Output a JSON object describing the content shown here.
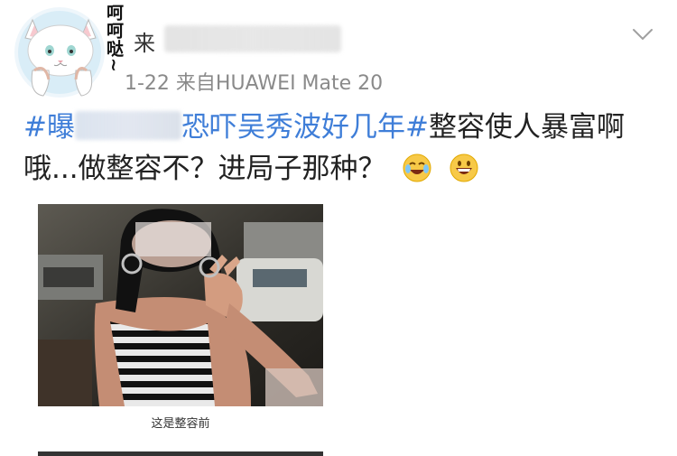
{
  "post": {
    "avatar_text": "呵呵哒~",
    "username_visible": "来",
    "meta": "1-22  来自HUAWEI Mate 20",
    "text": {
      "hashtag_1_prefix": "#曝",
      "hashtag_1_suffix": "恐吓吴秀波好几年#",
      "hashtag_2": "整容使人暴富啊",
      "line_2": "哦...做整容不？进局子那种？"
    },
    "image_caption": "这是整容前"
  },
  "colors": {
    "link": "#3f7ed8",
    "meta": "#8a8a8a",
    "text": "#222222"
  },
  "icons": [
    "cat-avatar-icon",
    "chevron-down-icon",
    "laughing-crying-emoji-icon",
    "grinning-emoji-icon"
  ]
}
